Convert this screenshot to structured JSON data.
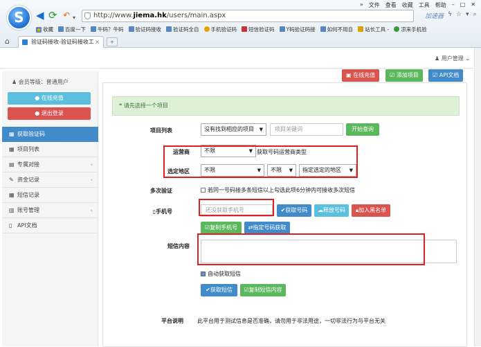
{
  "browser": {
    "menu": [
      "»",
      "文件",
      "查看",
      "收藏",
      "工具",
      "帮助"
    ],
    "address": {
      "prefix": "http://www.",
      "domain": "jiema.hk",
      "path": "/users/main.aspx"
    },
    "accelerator": "加速器",
    "bookmarks": [
      "收藏",
      "百度一下",
      "牛码？牛码",
      "验证码接收",
      "验证码全自",
      "手机验证码",
      "短信验证码",
      "Y码验证码接",
      "如何不用自",
      "站长工具 -",
      "凉来手机验"
    ],
    "tab_title": "验证码接收-验证码接收工"
  },
  "header": {
    "user_menu": "用户管理"
  },
  "sidebar": {
    "level_label": "会员等级：普通用户",
    "recharge_button": "在线充值",
    "logout_button": "退出登录",
    "items": [
      {
        "label": "获取验证码",
        "active": true
      },
      {
        "label": "项目列表"
      },
      {
        "label": "专属对接",
        "has_arrow": true
      },
      {
        "label": "资金记录",
        "has_arrow": true
      },
      {
        "label": "短信记录"
      },
      {
        "label": "账号管理",
        "has_arrow": true
      },
      {
        "label": "API文档"
      }
    ]
  },
  "toolbar": {
    "recharge": "在线充值",
    "add_project": "添加项目",
    "api_doc": "API文档"
  },
  "main": {
    "alert": "请先选择一个项目",
    "project_label": "项目列表",
    "project_select": "没有找到相应的项目",
    "project_search_placeholder": "项目关键词",
    "search_button": "开始查询",
    "operator_label": "运营商",
    "operator_select": "不限",
    "operator_hint": "获取号码运营商类型",
    "region_label": "选定地区",
    "region_select1": "不限",
    "region_select2": "不限",
    "region_select3": "指定选定的地区",
    "multi_label": "多次验证",
    "multi_hint": "若同一号码接多条短信以上勾选此项6分钟内可接收多次短信",
    "phone_label": "手机号",
    "phone_placeholder": "还没获取手机号",
    "get_number_button": "获取号码",
    "release_button": "释放号码",
    "blacklist_button": "加入黑名单",
    "copy_phone_button": "复制手机号",
    "specify_button": "指定号码获取",
    "sms_label": "短信内容",
    "auto_fetch_label": "自动获取短信",
    "get_sms_button": "获取短信",
    "copy_sms_button": "复制短信内容"
  },
  "footer": {
    "label": "平台说明",
    "text": "此平台用于测试信息是否准确，请勿用于非法用途，一切非法行为与平台无关"
  }
}
